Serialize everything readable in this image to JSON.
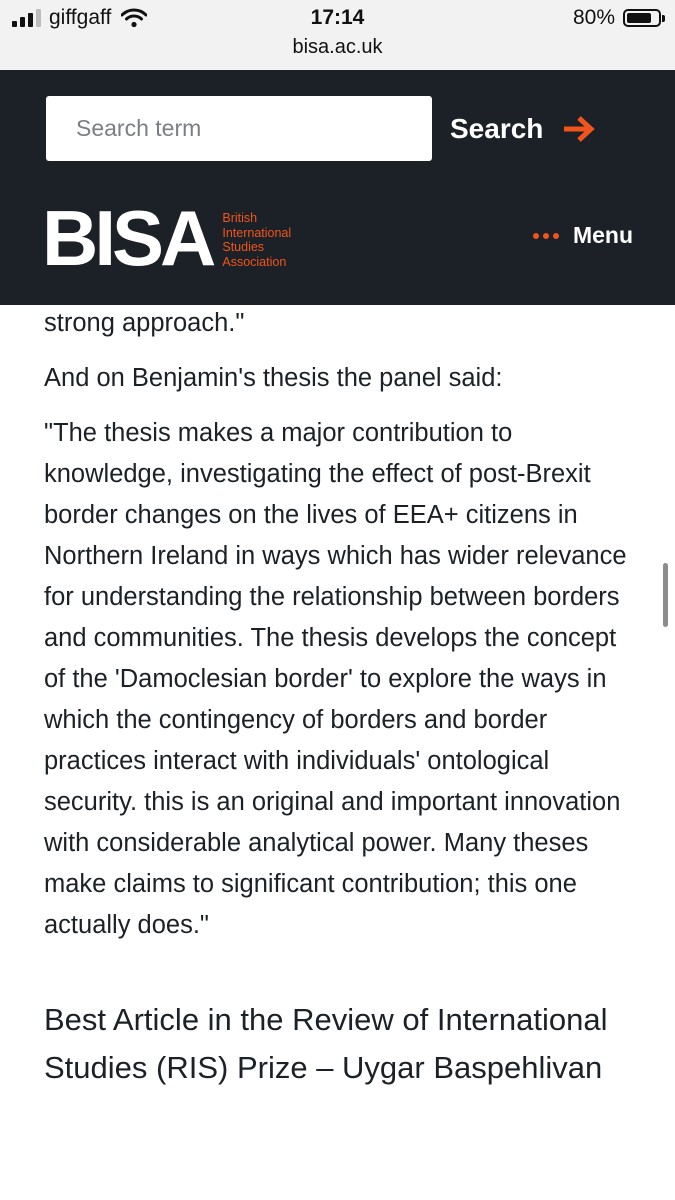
{
  "status_bar": {
    "carrier": "giffgaff",
    "time": "17:14",
    "battery": "80%",
    "battery_level": 0.8,
    "url": "bisa.ac.uk"
  },
  "header": {
    "search": {
      "placeholder": "Search term",
      "button_label": "Search"
    },
    "logo": {
      "word": "BISA",
      "subtitle_lines": [
        "British",
        "International",
        "Studies",
        "Association"
      ]
    },
    "menu_label": "Menu",
    "accent_color": "#f1541d",
    "background_color": "#1b2126"
  },
  "content": {
    "partial_paragraph": "strong approach.\"",
    "intro_paragraph": "And on Benjamin's thesis the panel said:",
    "quote_paragraph": "\"The thesis makes a major contribution to knowledge, investigating the effect of post-Brexit border changes on the lives of EEA+ citizens in Northern Ireland in ways which has wider relevance for understanding the relationship between borders and communities. The thesis develops the concept of the 'Damoclesian border' to explore the ways in which the contingency of borders and border practices interact with individuals' ontological security. this is an original and important innovation with considerable analytical power. Many theses make claims to significant contribution; this one actually does.\"",
    "heading": "Best Article in the Review of International Studies (RIS) Prize – Uygar Baspehlivan"
  }
}
